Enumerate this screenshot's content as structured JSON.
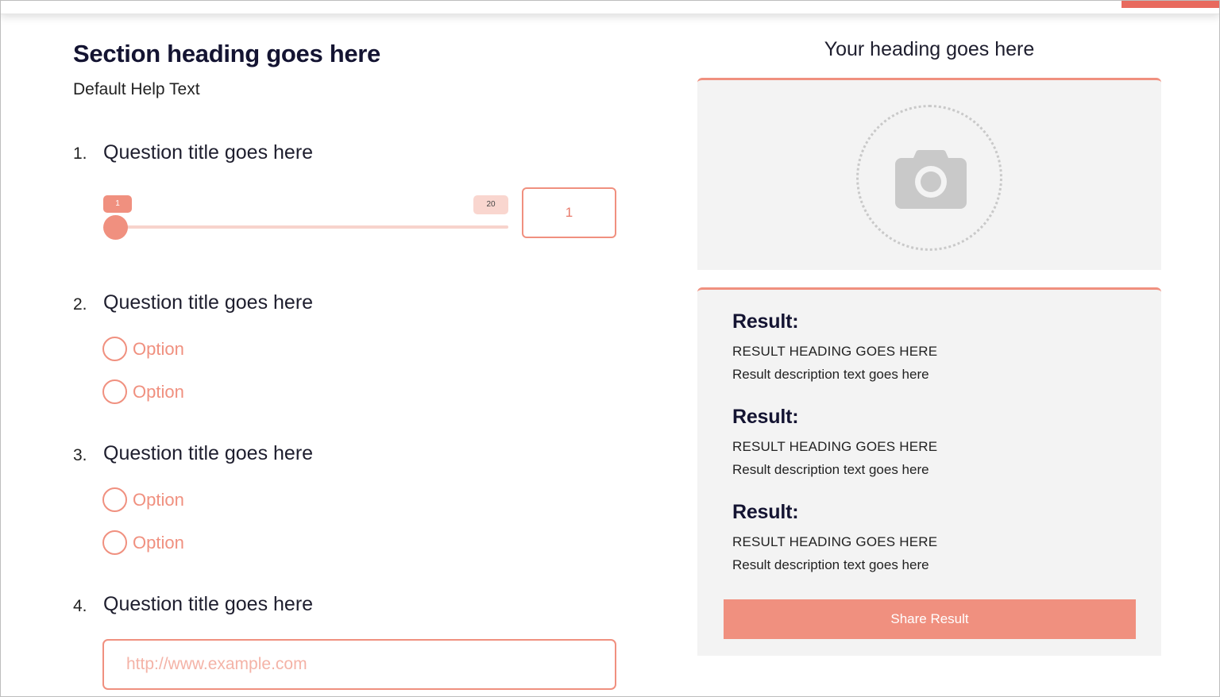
{
  "form": {
    "section_heading": "Section heading goes here",
    "help_text": "Default Help Text",
    "questions": [
      {
        "number": "1.",
        "title": "Question title goes here"
      },
      {
        "number": "2.",
        "title": "Question title goes here"
      },
      {
        "number": "3.",
        "title": "Question title goes here"
      },
      {
        "number": "4.",
        "title": "Question title goes here"
      }
    ],
    "slider": {
      "min_label": "1",
      "max_label": "20",
      "value": "1"
    },
    "q2_options": [
      "Option",
      "Option"
    ],
    "q3_options": [
      "Option",
      "Option"
    ],
    "url_placeholder": "http://www.example.com"
  },
  "results_panel": {
    "heading": "Your heading goes here",
    "image_placeholder_icon": "camera-icon",
    "results": [
      {
        "label": "Result:",
        "heading": "RESULT HEADING GOES HERE",
        "description": "Result description text goes here"
      },
      {
        "label": "Result:",
        "heading": "RESULT HEADING GOES HERE",
        "description": "Result description text goes here"
      },
      {
        "label": "Result:",
        "heading": "RESULT HEADING GOES HERE",
        "description": "Result description text goes here"
      }
    ],
    "share_label": "Share Result"
  },
  "colors": {
    "accent": "#f0907f",
    "accent_light": "#f9d6cf",
    "panel_bg": "#f3f3f3",
    "heading": "#141432"
  }
}
